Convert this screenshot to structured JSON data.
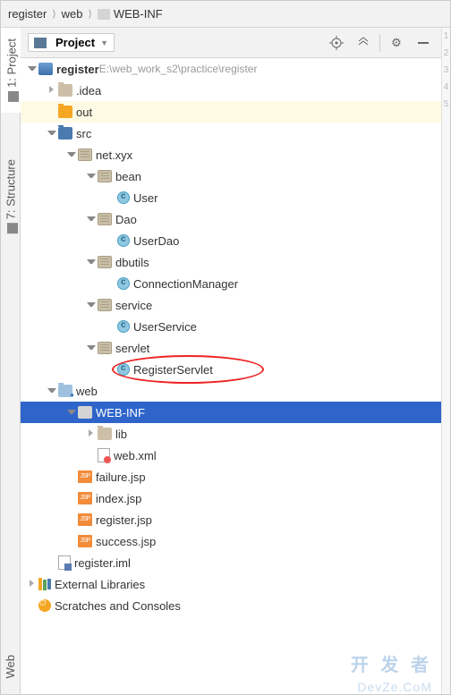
{
  "breadcrumb": [
    "register",
    "web",
    "WEB-INF"
  ],
  "left_tabs": [
    {
      "label": "1: Project",
      "key": "project"
    },
    {
      "label": "7: Structure",
      "key": "structure"
    }
  ],
  "bottom_tab": "Web",
  "toolbar": {
    "selector": "Project"
  },
  "gutter_lines": [
    "1",
    "2",
    "3",
    "4",
    "5"
  ],
  "tree": [
    {
      "indent": 0,
      "arrow": "down",
      "icon": "module",
      "label": "register",
      "suffix": "E:\\web_work_s2\\practice\\register",
      "bold": true
    },
    {
      "indent": 1,
      "arrow": "right",
      "icon": "folder",
      "label": ".idea"
    },
    {
      "indent": 1,
      "arrow": "none",
      "icon": "folder-orange",
      "label": "out",
      "highlight": "out"
    },
    {
      "indent": 1,
      "arrow": "down",
      "icon": "folder-blue",
      "label": "src"
    },
    {
      "indent": 2,
      "arrow": "down",
      "icon": "pkg",
      "label": "net.xyx"
    },
    {
      "indent": 3,
      "arrow": "down",
      "icon": "pkg",
      "label": "bean"
    },
    {
      "indent": 4,
      "arrow": "none",
      "icon": "class-c",
      "label": "User"
    },
    {
      "indent": 3,
      "arrow": "down",
      "icon": "pkg",
      "label": "Dao"
    },
    {
      "indent": 4,
      "arrow": "none",
      "icon": "class-c",
      "label": "UserDao"
    },
    {
      "indent": 3,
      "arrow": "down",
      "icon": "pkg",
      "label": "dbutils"
    },
    {
      "indent": 4,
      "arrow": "none",
      "icon": "class-c",
      "label": "ConnectionManager"
    },
    {
      "indent": 3,
      "arrow": "down",
      "icon": "pkg",
      "label": "service"
    },
    {
      "indent": 4,
      "arrow": "none",
      "icon": "class-c",
      "label": "UserService"
    },
    {
      "indent": 3,
      "arrow": "down",
      "icon": "pkg",
      "label": "servlet"
    },
    {
      "indent": 4,
      "arrow": "none",
      "icon": "class-c",
      "label": "RegisterServlet",
      "circled": true
    },
    {
      "indent": 1,
      "arrow": "down",
      "icon": "web-folder",
      "label": "web"
    },
    {
      "indent": 2,
      "arrow": "down",
      "icon": "folder-g",
      "label": "WEB-INF",
      "selected": true
    },
    {
      "indent": 3,
      "arrow": "right",
      "icon": "folder",
      "label": "lib"
    },
    {
      "indent": 3,
      "arrow": "none",
      "icon": "xml",
      "label": "web.xml"
    },
    {
      "indent": 2,
      "arrow": "none",
      "icon": "jsp",
      "label": "failure.jsp"
    },
    {
      "indent": 2,
      "arrow": "none",
      "icon": "jsp",
      "label": "index.jsp"
    },
    {
      "indent": 2,
      "arrow": "none",
      "icon": "jsp",
      "label": "register.jsp"
    },
    {
      "indent": 2,
      "arrow": "none",
      "icon": "jsp",
      "label": "success.jsp"
    },
    {
      "indent": 1,
      "arrow": "none",
      "icon": "iml",
      "label": "register.iml"
    },
    {
      "indent": 0,
      "arrow": "right",
      "icon": "libs",
      "label": "External Libraries"
    },
    {
      "indent": 0,
      "arrow": "none",
      "icon": "scratch",
      "label": "Scratches and Consoles"
    }
  ],
  "watermark": {
    "line1": "开 发 者",
    "line2": "DevZe.CoM"
  }
}
